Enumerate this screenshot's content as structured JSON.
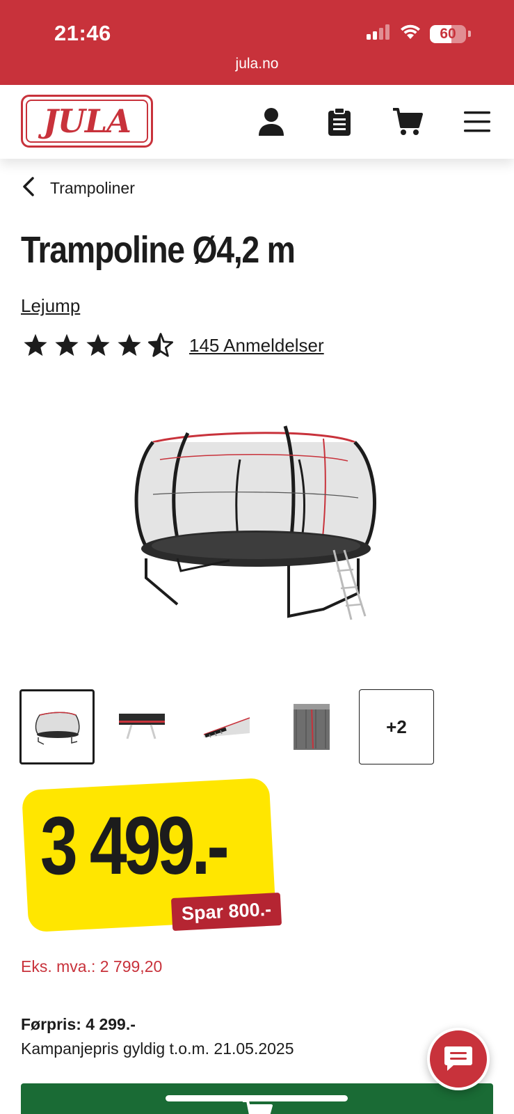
{
  "status_bar": {
    "time": "21:46",
    "battery_level": "60",
    "battery_fraction": 0.6,
    "url": "jula.no"
  },
  "header": {
    "logo_text": "JULA",
    "icons": [
      "account-icon",
      "shopping-list-icon",
      "cart-icon",
      "menu-icon"
    ]
  },
  "breadcrumb": {
    "label": "Trampoliner"
  },
  "product": {
    "title": "Trampoline Ø4,2 m",
    "brand": "Lejump",
    "rating": 4.5,
    "reviews_label": "145 Anmeldelser"
  },
  "gallery": {
    "more_label": "+2",
    "thumbnail_count": 4
  },
  "pricing": {
    "price": "3 499.-",
    "save_label": "Spar 800.-",
    "ex_vat": "Eks. mva.: 2 799,20",
    "previous_price": "Førpris: 4 299.-",
    "campaign_note": "Kampanjepris gyldig t.o.m. 21.05.2025"
  },
  "colors": {
    "brand_red": "#c8323b",
    "price_yellow": "#ffe600",
    "save_red": "#b52532",
    "cart_green": "#1a6b35"
  }
}
